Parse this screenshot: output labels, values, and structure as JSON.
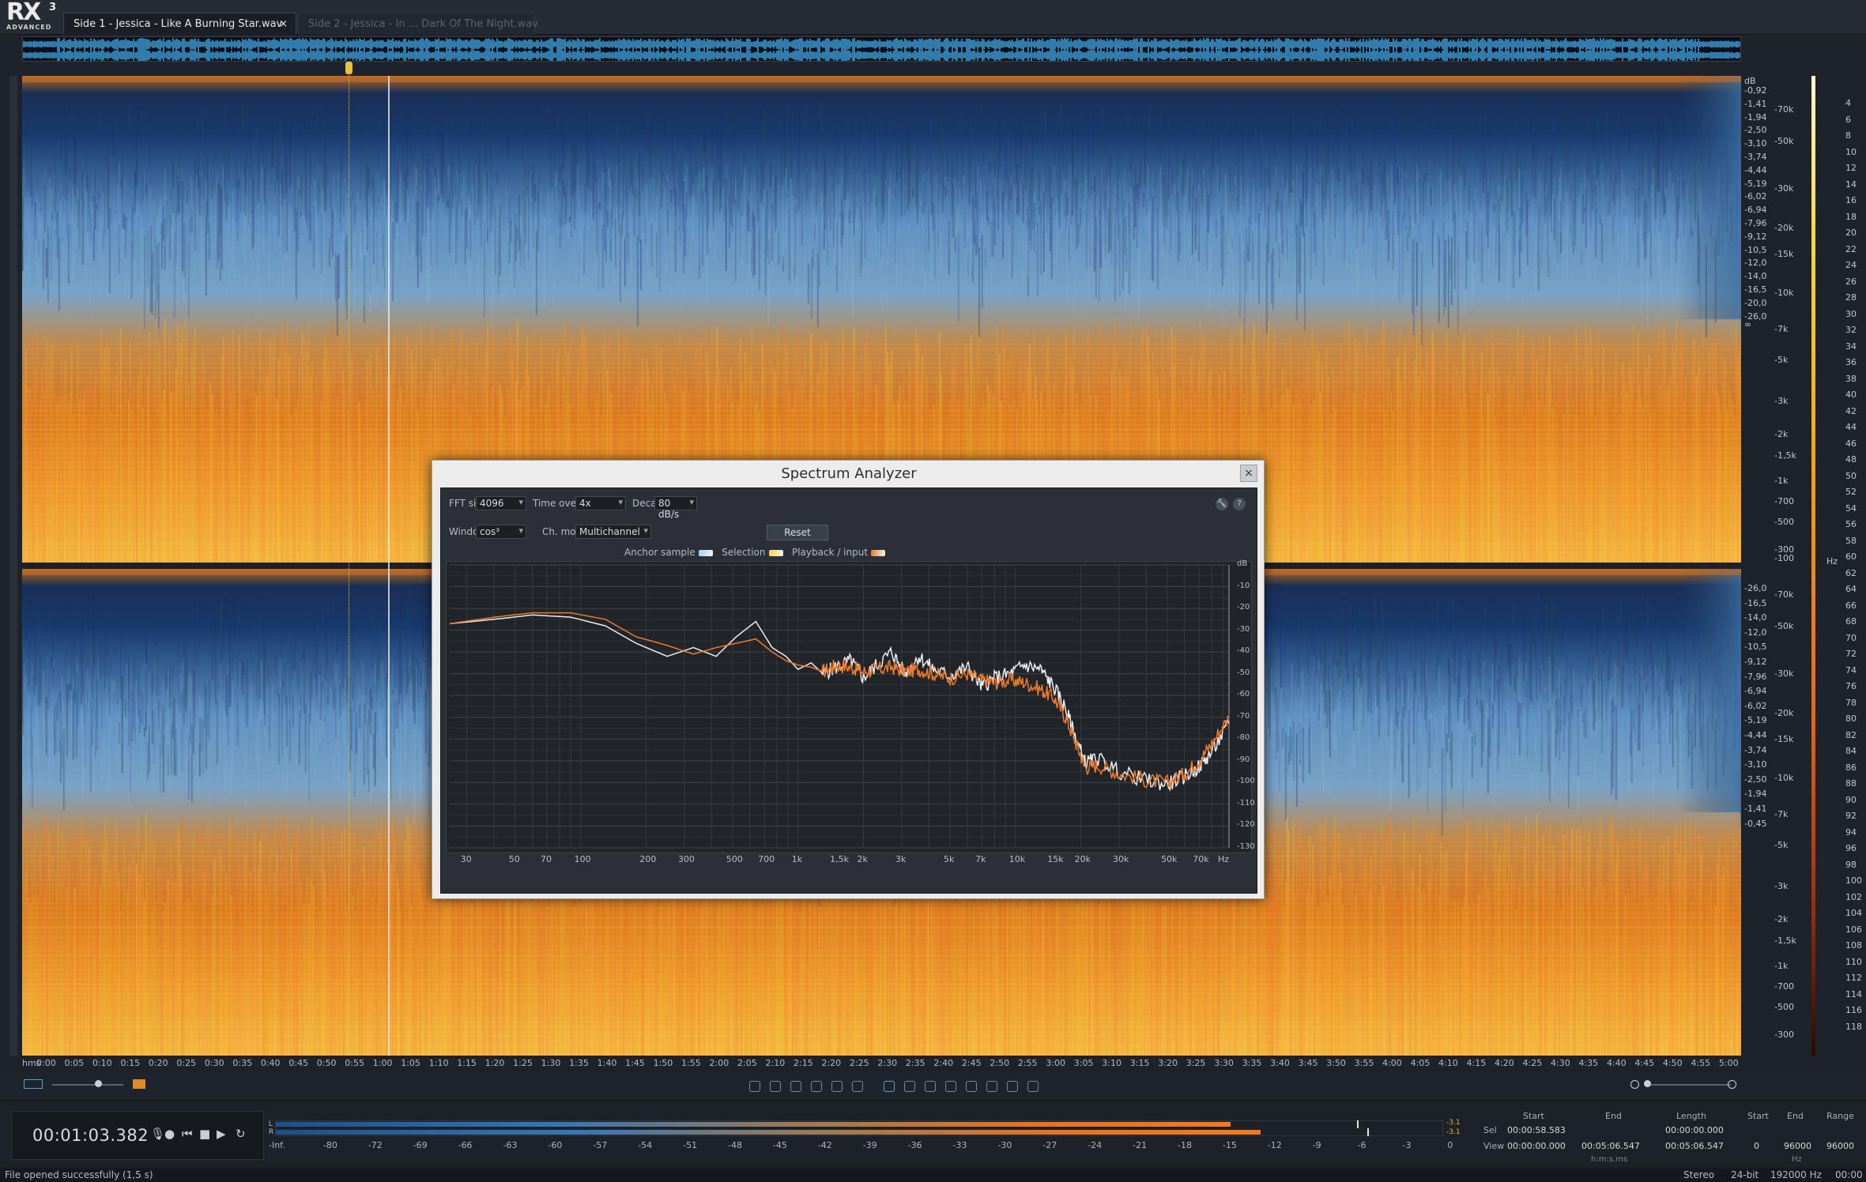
{
  "app": {
    "logo": "RX",
    "logo_version": "3",
    "logo_edition": "ADVANCED"
  },
  "tabs": [
    {
      "label": "Side 1 - Jessica - Like A Burning Star.wav",
      "close": "×"
    },
    {
      "label": "Side 2 - Jessica - In ... Dark Of The Night.wav"
    }
  ],
  "scale": {
    "db_unit": "dB",
    "db_labels": [
      "-0,92",
      "-1,41",
      "-1,94",
      "-2,50",
      "-3,10",
      "-3,74",
      "-4,44",
      "-5,19",
      "-6,02",
      "-6,94",
      "-7,96",
      "-9,12",
      "-10,5",
      "-12,0",
      "-14,0",
      "-16,5",
      "-20,0",
      "-26,0",
      "∞",
      "-26,0",
      "-16,5",
      "-14,0",
      "-12,0",
      "-10,5",
      "-9,12",
      "-7,96",
      "-6,94",
      "-6,02",
      "-5,19",
      "-4,44",
      "-3,74",
      "-3,10",
      "-2,50",
      "-1,94",
      "-1,41",
      "-0,45"
    ],
    "hz_labels": [
      "-70k",
      "-50k",
      "-30k",
      "-20k",
      "-15k",
      "-10k",
      "-7k",
      "-5k",
      "-3k",
      "-2k",
      "-1,5k",
      "-1k",
      "-700",
      "-500",
      "-300",
      "-100"
    ],
    "hz_unit": "Hz",
    "meter_labels": [
      "4",
      "6",
      "8",
      "10",
      "12",
      "14",
      "16",
      "18",
      "20",
      "22",
      "24",
      "26",
      "28",
      "30",
      "32",
      "34",
      "36",
      "38",
      "40",
      "42",
      "44",
      "46",
      "48",
      "50",
      "52",
      "54",
      "56",
      "58",
      "60",
      "62",
      "64",
      "66",
      "68",
      "70",
      "72",
      "74",
      "76",
      "78",
      "80",
      "82",
      "84",
      "86",
      "88",
      "90",
      "92",
      "94",
      "96",
      "98",
      "100",
      "102",
      "104",
      "106",
      "108",
      "110",
      "112",
      "114",
      "116",
      "118"
    ]
  },
  "ruler": {
    "unit": "hms",
    "ticks": [
      "0:00",
      "0:05",
      "0:10",
      "0:15",
      "0:20",
      "0:25",
      "0:30",
      "0:35",
      "0:40",
      "0:45",
      "0:50",
      "0:55",
      "1:00",
      "1:05",
      "1:10",
      "1:15",
      "1:20",
      "1:25",
      "1:30",
      "1:35",
      "1:40",
      "1:45",
      "1:50",
      "1:55",
      "2:00",
      "2:05",
      "2:10",
      "2:15",
      "2:20",
      "2:25",
      "2:30",
      "2:35",
      "2:40",
      "2:45",
      "2:50",
      "2:55",
      "3:00",
      "3:05",
      "3:10",
      "3:15",
      "3:20",
      "3:25",
      "3:30",
      "3:35",
      "3:40",
      "3:45",
      "3:50",
      "3:55",
      "4:00",
      "4:05",
      "4:10",
      "4:15",
      "4:20",
      "4:25",
      "4:30",
      "4:35",
      "4:40",
      "4:45",
      "4:50",
      "4:55",
      "5:00"
    ]
  },
  "playback_position_fraction": 0.213,
  "transport": {
    "time": "00:01:03.382",
    "mic": "🎙",
    "record": "●",
    "rewind": "⏮",
    "stop": "■",
    "play": "▶",
    "loop": "↻"
  },
  "level_meter": {
    "left_label": "L",
    "right_label": "R",
    "left_peak": "-3.1",
    "right_peak": "-3.1",
    "ticks": [
      "-Inf.",
      "-80",
      "-72",
      "-69",
      "-66",
      "-63",
      "-60",
      "-57",
      "-54",
      "-51",
      "-48",
      "-45",
      "-42",
      "-39",
      "-36",
      "-33",
      "-30",
      "-27",
      "-24",
      "-21",
      "-18",
      "-15",
      "-12",
      "-9",
      "-6",
      "-3",
      "0"
    ],
    "left_level": 0.94,
    "right_level": 0.97
  },
  "selection": {
    "col_start": "Start",
    "col_end": "End",
    "col_length": "Length",
    "sel_label": "Sel",
    "view_label": "View",
    "sel_start": "00:00:58.583",
    "sel_end": "",
    "sel_length": "00:00:00.000",
    "view_start": "00:00:00.000",
    "view_end": "00:05:06.547",
    "view_length": "00:05:06.547",
    "time_unit": "h:m:s.ms",
    "freq_start_label": "Start",
    "freq_end_label": "End",
    "freq_range_label": "Range",
    "freq_start": "0",
    "freq_end": "96000",
    "freq_range": "96000",
    "freq_unit": "Hz"
  },
  "status": {
    "message": "File opened successfully (1,5 s)",
    "channels": "Stereo",
    "bit_depth": "24-bit",
    "sample_rate": "192000 Hz",
    "time": "00:00"
  },
  "dialog": {
    "title": "Spectrum Analyzer",
    "close": "×",
    "fft_label": "FFT size",
    "fft_value": "4096",
    "overlap_label": "Time overlap",
    "overlap_value": "4x",
    "decay_label": "Decay",
    "decay_value": "80 dB/s",
    "window_label": "Window",
    "window_value": "cos³",
    "chmode_label": "Ch. mode",
    "chmode_value": "Multichannel",
    "reset_label": "Reset",
    "legend": {
      "anchor": "Anchor sample",
      "selection": "Selection",
      "playback": "Playback / input"
    },
    "settings_icon": "🔧",
    "help_icon": "?"
  },
  "chart_data": {
    "type": "line",
    "title": "",
    "xlabel": "Hz",
    "ylabel": "dB",
    "x_scale": "log",
    "xlim": [
      25,
      96000
    ],
    "ylim": [
      -130,
      0
    ],
    "x_ticks": [
      "30",
      "50",
      "70",
      "100",
      "200",
      "300",
      "500",
      "700",
      "1k",
      "1,5k",
      "2k",
      "3k",
      "5k",
      "7k",
      "10k",
      "15k",
      "20k",
      "30k",
      "50k",
      "70k",
      "Hz"
    ],
    "y_ticks": [
      "dB",
      "-10",
      "-20",
      "-30",
      "-40",
      "-50",
      "-60",
      "-70",
      "-80",
      "-90",
      "-100",
      "-110",
      "-120",
      "-130"
    ],
    "series": [
      {
        "name": "Anchor sample",
        "color": "#e8eef4",
        "x": [
          25,
          40,
          60,
          90,
          130,
          180,
          250,
          330,
          420,
          520,
          640,
          760,
          880,
          1000,
          1150,
          1300,
          1500,
          1750,
          2000,
          2300,
          2700,
          3100,
          3600,
          4200,
          5000,
          6000,
          7000,
          8000,
          9500,
          11000,
          13000,
          15000,
          17000,
          19000,
          21000,
          24000,
          30000,
          40000,
          50000,
          60000,
          70000,
          80000,
          96000
        ],
        "y": [
          -27,
          -25,
          -23,
          -24,
          -28,
          -36,
          -42,
          -38,
          -42,
          -33,
          -26,
          -38,
          -42,
          -48,
          -45,
          -50,
          -47,
          -44,
          -52,
          -46,
          -40,
          -50,
          -42,
          -48,
          -51,
          -47,
          -56,
          -52,
          -50,
          -46,
          -48,
          -56,
          -66,
          -80,
          -91,
          -89,
          -95,
          -99,
          -101,
          -97,
          -93,
          -86,
          -73
        ]
      },
      {
        "name": "Playback / input",
        "color": "#ee7a2a",
        "x": [
          25,
          40,
          60,
          90,
          130,
          180,
          250,
          330,
          420,
          520,
          640,
          760,
          880,
          1000,
          1150,
          1300,
          1500,
          1750,
          2000,
          2300,
          2700,
          3100,
          3600,
          4200,
          5000,
          6000,
          7000,
          8000,
          9500,
          11000,
          13000,
          15000,
          17000,
          19000,
          21000,
          24000,
          30000,
          40000,
          50000,
          60000,
          70000,
          80000,
          96000
        ],
        "y": [
          -27,
          -24,
          -22,
          -22,
          -25,
          -33,
          -37,
          -41,
          -38,
          -36,
          -34,
          -40,
          -44,
          -46,
          -47,
          -49,
          -46,
          -47,
          -49,
          -48,
          -47,
          -49,
          -48,
          -50,
          -52,
          -50,
          -53,
          -54,
          -53,
          -54,
          -57,
          -61,
          -70,
          -82,
          -93,
          -92,
          -96,
          -99,
          -100,
          -96,
          -90,
          -82,
          -70
        ]
      }
    ]
  }
}
